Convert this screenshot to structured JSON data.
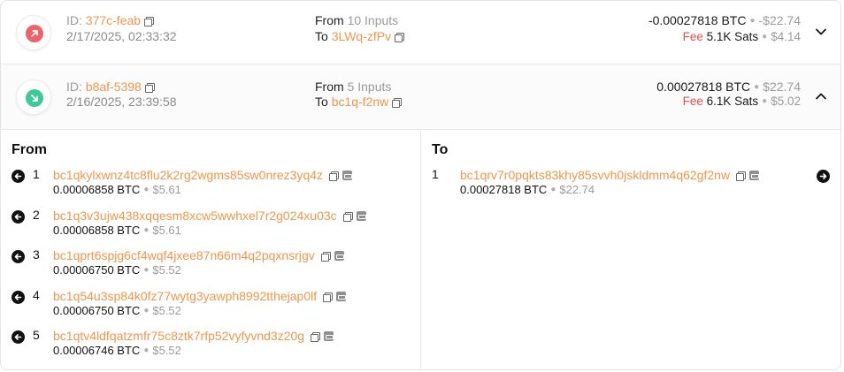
{
  "transactions": [
    {
      "direction": "outgoing",
      "dir_color": "#f0616a",
      "id_label": "ID:",
      "id_value": "377c-feab",
      "date": "2/17/2025, 02:33:32",
      "from_label": "From",
      "from_count": "10 Inputs",
      "to_label": "To",
      "to_value": "3LWq-zfPv",
      "amount": "-0.00027818 BTC",
      "amount_usd": "-$22.74",
      "fee_label": "Fee",
      "fee_value": "5.1K Sats",
      "fee_usd": "$4.14",
      "expanded": false
    },
    {
      "direction": "incoming",
      "dir_color": "#3ec99a",
      "id_label": "ID:",
      "id_value": "b8af-5398",
      "date": "2/16/2025, 23:39:58",
      "from_label": "From",
      "from_count": "5 Inputs",
      "to_label": "To",
      "to_value": "bc1q-f2nw",
      "amount": "0.00027818 BTC",
      "amount_usd": "$22.74",
      "fee_label": "Fee",
      "fee_value": "6.1K Sats",
      "fee_usd": "$5.02",
      "expanded": true
    }
  ],
  "detail": {
    "from_title": "From",
    "to_title": "To",
    "inputs": [
      {
        "index": "1",
        "address": "bc1qkylxwnz4tc8flu2k2rg2wgms85sw0nrez3yq4z",
        "btc": "0.00006858",
        "unit": "BTC",
        "usd": "$5.61"
      },
      {
        "index": "2",
        "address": "bc1q3v3ujw438xqqesm8xcw5wwhxel7r2g024xu03c",
        "btc": "0.00006858",
        "unit": "BTC",
        "usd": "$5.61"
      },
      {
        "index": "3",
        "address": "bc1qprt6spjg6cf4wqf4jxee87n66m4q2pqxnsrjgv",
        "btc": "0.00006750",
        "unit": "BTC",
        "usd": "$5.52"
      },
      {
        "index": "4",
        "address": "bc1q54u3sp84k0fz77wytg3yawph8992tthejap0lf",
        "btc": "0.00006750",
        "unit": "BTC",
        "usd": "$5.52"
      },
      {
        "index": "5",
        "address": "bc1qtv4ldfqatzmfr75c8ztk7rfp52vyfyvnd3z20g",
        "btc": "0.00006746",
        "unit": "BTC",
        "usd": "$5.52"
      }
    ],
    "outputs": [
      {
        "index": "1",
        "address": "bc1qrv7r0pqkts83khy85svvh0jskldmm4q62gf2nw",
        "btc": "0.00027818",
        "unit": "BTC",
        "usd": "$22.74"
      }
    ]
  },
  "icons": {
    "outgoing": "arrow-up-right-icon",
    "incoming": "arrow-down-right-icon",
    "input_arrow": "arrow-left-icon",
    "output_arrow": "arrow-right-icon",
    "copy": "copy-icon",
    "explorer": "explorer-icon",
    "collapsed": "chevron-down-icon",
    "expanded": "chevron-up-icon"
  }
}
